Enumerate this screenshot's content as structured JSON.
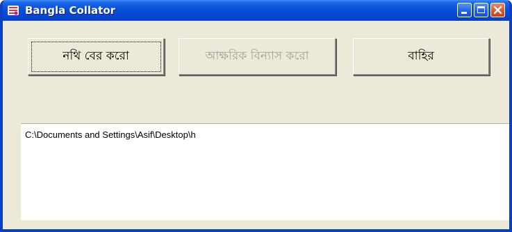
{
  "window": {
    "title": "Bangla Collator",
    "icon": "app-icon",
    "controls": {
      "minimize_icon": "minimize-icon",
      "maximize_icon": "maximize-icon",
      "close_icon": "close-icon"
    }
  },
  "toolbar": {
    "browse_label": "নথি বের করো",
    "sort_label": "আক্ষরিক বিন্যাস করো",
    "sort_disabled": true,
    "exit_label": "বাহির"
  },
  "output": {
    "path_text": "C:\\Documents and Settings\\Asif\\Desktop\\h"
  },
  "colors": {
    "title_bar": "#0a4fd8",
    "window_bg": "#ece9d8",
    "disabled_text": "#a0a0a0",
    "close_button": "#d8552f"
  }
}
